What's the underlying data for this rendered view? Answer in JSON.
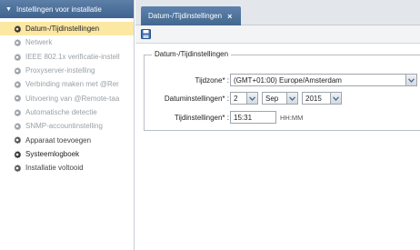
{
  "nav": {
    "header": "Instellingen voor installatie",
    "items": [
      {
        "label": "Datum-/Tijdinstellingen"
      },
      {
        "label": "Netwerk"
      },
      {
        "label": "IEEE 802.1x verificatie-instell"
      },
      {
        "label": "Proxyserver-instelling"
      },
      {
        "label": "Verbinding maken met @Rer"
      },
      {
        "label": "Uitvoering van @Remote-taa"
      },
      {
        "label": "Automatische detectie"
      },
      {
        "label": "SNMP-accountinstelling"
      },
      {
        "label": "Apparaat toevoegen"
      },
      {
        "label": "Systeemlogboek"
      },
      {
        "label": "Installatie voltooid"
      }
    ]
  },
  "tab": {
    "label": "Datum-/Tijdinstellingen",
    "close": "×"
  },
  "form": {
    "legend": "Datum-/Tijdinstellingen",
    "timezone": {
      "label": "Tijdzone* :",
      "value": "(GMT+01:00) Europe/Amsterdam"
    },
    "date": {
      "label": "Datuminstellingen* :",
      "day": "2",
      "month": "Sep",
      "year": "2015"
    },
    "time": {
      "label": "Tijdinstellingen* :",
      "value": "15:31",
      "hint": "HH:MM"
    }
  },
  "colors": {
    "accent": "#4a6f98",
    "active_row": "#fbe8a3",
    "gear": "#666b72"
  }
}
